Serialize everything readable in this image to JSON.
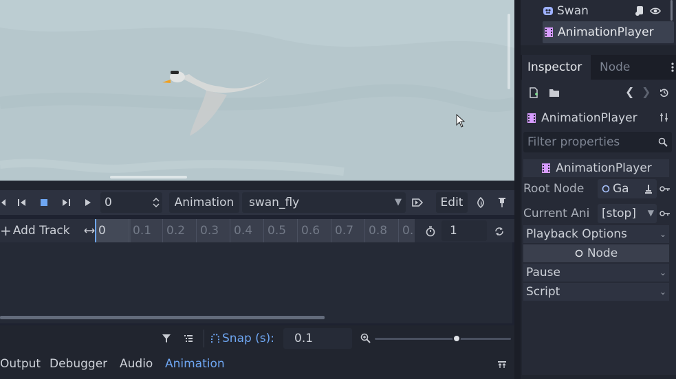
{
  "animation_toolbar": {
    "frame_value": "0",
    "animation_menu": "Animation",
    "current_animation": "swan_fly",
    "edit_label": "Edit"
  },
  "timeline": {
    "add_track_label": "Add Track",
    "ticks": [
      "0",
      "0.1",
      "0.2",
      "0.3",
      "0.4",
      "0.5",
      "0.6",
      "0.7",
      "0.8",
      "0."
    ],
    "length_value": "1"
  },
  "snap": {
    "label": "Snap (s):",
    "value": "0.1",
    "zoom_level": 0.6
  },
  "bottom_tabs": [
    "Output",
    "Debugger",
    "Audio",
    "Animation"
  ],
  "active_bottom_tab": "Animation",
  "scene_tree": {
    "items": [
      {
        "label": "Swan",
        "icon": "sprite-node-icon"
      },
      {
        "label": "AnimationPlayer",
        "icon": "animation-player-icon"
      }
    ]
  },
  "inspector": {
    "tabs": [
      "Inspector",
      "Node"
    ],
    "object_name": "AnimationPlayer",
    "filter_placeholder": "Filter properties",
    "class_header": "AnimationPlayer",
    "properties": {
      "root_node_label": "Root Node",
      "root_node_value": "Ga",
      "current_anim_label": "Current Ani",
      "current_anim_value": "[stop]"
    },
    "sections": {
      "playback": "Playback Options",
      "node": "Node",
      "pause": "Pause",
      "script": "Script"
    }
  },
  "colors": {
    "accent": "#6ea6f2",
    "viewport_sky": "#b7c8cd",
    "panel_bg": "#21252f",
    "toolbar_bg": "#2d3240",
    "anim_icon": "#d79cff"
  }
}
